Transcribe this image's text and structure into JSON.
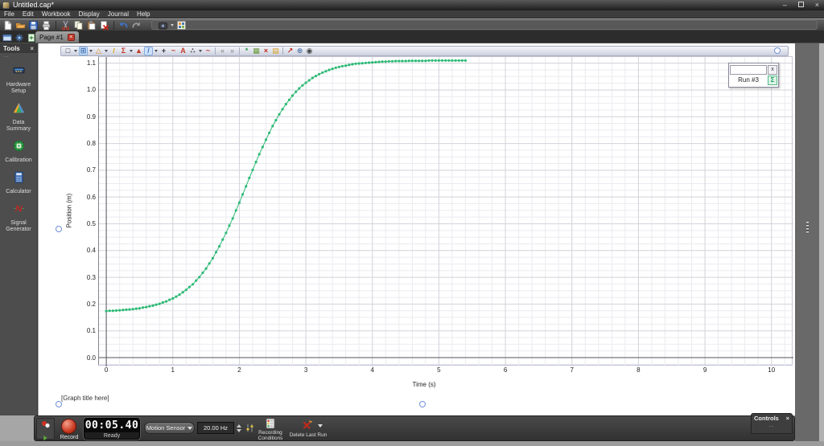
{
  "window": {
    "title": "Untitled.cap*"
  },
  "menu": {
    "items": [
      "File",
      "Edit",
      "Workbook",
      "Display",
      "Journal",
      "Help"
    ]
  },
  "main_toolbar": {
    "icons": [
      "new-file",
      "open-file",
      "save-file",
      "print",
      "sep",
      "cut",
      "copy",
      "paste",
      "delete-page",
      "sep",
      "undo",
      "redo"
    ],
    "right_icons": [
      "snapshot",
      "workbook-layout"
    ]
  },
  "tab_bar": {
    "icons": [
      "display-selector",
      "page-options",
      "add-page"
    ],
    "active_tab": "Page #1"
  },
  "tools_panel": {
    "title": "Tools",
    "items": [
      {
        "icon": "hardware-setup-icon",
        "label": "Hardware\nSetup"
      },
      {
        "icon": "data-summary-icon",
        "label": "Data\nSummary"
      },
      {
        "icon": "calibration-icon",
        "label": "Calibration"
      },
      {
        "icon": "calculator-icon",
        "label": "Calculator"
      },
      {
        "icon": "signal-generator-icon",
        "label": "Signal\nGenerator"
      }
    ]
  },
  "graph_display": {
    "toolbar_icons": [
      {
        "name": "selection-tool",
        "glyph": "□",
        "color": "#444444",
        "caret": true
      },
      {
        "name": "scale-to-fit-tool",
        "glyph": "⊞",
        "color": "#2a62a8",
        "caret": true,
        "active": true
      },
      {
        "name": "data-highlighter-tool",
        "glyph": "△",
        "color": "#e08a1e",
        "caret": true
      },
      {
        "name": "highlighter-pencil-tool",
        "glyph": "/",
        "color": "#d4a913"
      },
      {
        "name": "statistics-tool",
        "glyph": "Σ",
        "color": "#c23a2a",
        "caret": true
      },
      {
        "name": "delta-tool",
        "glyph": "▲",
        "color": "#c23a2a"
      },
      {
        "name": "slope-tool",
        "glyph": "/",
        "color": "#3a6fd0",
        "caret": true,
        "active": true
      },
      {
        "name": "coordinates-tool",
        "glyph": "+",
        "color": "#333333"
      },
      {
        "name": "curve-fit-tool",
        "glyph": "~",
        "color": "#c23a2a"
      },
      {
        "name": "annotation-tool",
        "glyph": "A",
        "color": "#c23a2a"
      },
      {
        "name": "multi-coordinates-tool",
        "glyph": "∴",
        "color": "#555555",
        "caret": true
      },
      {
        "name": "prediction-tool",
        "glyph": "~",
        "color": "#c23a2a"
      },
      {
        "name": "sep"
      },
      {
        "name": "previous-run-button",
        "glyph": "«",
        "color": "#9a9a9a"
      },
      {
        "name": "next-run-button",
        "glyph": "»",
        "color": "#9a9a9a"
      },
      {
        "name": "sep"
      },
      {
        "name": "add-display-button",
        "glyph": "*",
        "color": "#2e9e4e"
      },
      {
        "name": "select-runs-button",
        "glyph": "▦",
        "color": "#6a9a3a"
      },
      {
        "name": "delete-run-button",
        "glyph": "×",
        "color": "#c0281c"
      },
      {
        "name": "copy-display-button",
        "glyph": "▤",
        "color": "#d8a020"
      },
      {
        "name": "sep"
      },
      {
        "name": "pin-tool",
        "glyph": "↗",
        "color": "#c0281c"
      },
      {
        "name": "properties-button",
        "glyph": "⊛",
        "color": "#5577aa"
      },
      {
        "name": "visibility-button",
        "glyph": "◉",
        "color": "#444444"
      }
    ],
    "legend": {
      "title_field_value": "",
      "close_label": "x",
      "run_label": "Run #3",
      "run_selector_glyph": "Σ"
    },
    "title_placeholder": "[Graph title here]"
  },
  "chart_data": {
    "type": "line",
    "title": "[Graph title here]",
    "xlabel": "Time (s)",
    "ylabel": "Position (m)",
    "xlim": [
      -0.11,
      10.33
    ],
    "ylim": [
      -0.033,
      1.123
    ],
    "x_ticks": [
      0,
      1,
      2,
      3,
      4,
      5,
      6,
      7,
      8,
      9,
      10
    ],
    "y_ticks": [
      0.0,
      0.1,
      0.2,
      0.3,
      0.4,
      0.5,
      0.6,
      0.7,
      0.8,
      0.9,
      1.0,
      1.1
    ],
    "x_minor_step": 0.2,
    "y_minor_step": 0.025,
    "grid": true,
    "legend_position": "top-right",
    "colors": {
      "axis": "#52525c",
      "grid_major": "#d2d2da",
      "grid_minor": "#ebebf0"
    },
    "series": [
      {
        "name": "Run #3",
        "color": "#2eba76",
        "marker": "circle",
        "points": [
          [
            0.0,
            0.174
          ],
          [
            0.05,
            0.175
          ],
          [
            0.1,
            0.175
          ],
          [
            0.15,
            0.176
          ],
          [
            0.2,
            0.177
          ],
          [
            0.25,
            0.178
          ],
          [
            0.3,
            0.179
          ],
          [
            0.35,
            0.18
          ],
          [
            0.4,
            0.181
          ],
          [
            0.45,
            0.183
          ],
          [
            0.5,
            0.184
          ],
          [
            0.55,
            0.187
          ],
          [
            0.6,
            0.189
          ],
          [
            0.65,
            0.192
          ],
          [
            0.7,
            0.194
          ],
          [
            0.75,
            0.198
          ],
          [
            0.8,
            0.201
          ],
          [
            0.85,
            0.206
          ],
          [
            0.9,
            0.21
          ],
          [
            0.95,
            0.216
          ],
          [
            1.0,
            0.221
          ],
          [
            1.05,
            0.228
          ],
          [
            1.1,
            0.235
          ],
          [
            1.15,
            0.244
          ],
          [
            1.2,
            0.253
          ],
          [
            1.25,
            0.264
          ],
          [
            1.3,
            0.274
          ],
          [
            1.35,
            0.288
          ],
          [
            1.4,
            0.301
          ],
          [
            1.45,
            0.317
          ],
          [
            1.5,
            0.333
          ],
          [
            1.55,
            0.352
          ],
          [
            1.6,
            0.371
          ],
          [
            1.65,
            0.394
          ],
          [
            1.7,
            0.416
          ],
          [
            1.75,
            0.441
          ],
          [
            1.8,
            0.466
          ],
          [
            1.85,
            0.493
          ],
          [
            1.9,
            0.52
          ],
          [
            1.95,
            0.55
          ],
          [
            2.0,
            0.579
          ],
          [
            2.05,
            0.61
          ],
          [
            2.1,
            0.64
          ],
          [
            2.15,
            0.671
          ],
          [
            2.2,
            0.701
          ],
          [
            2.25,
            0.731
          ],
          [
            2.3,
            0.76
          ],
          [
            2.35,
            0.787
          ],
          [
            2.4,
            0.814
          ],
          [
            2.45,
            0.84
          ],
          [
            2.5,
            0.865
          ],
          [
            2.55,
            0.887
          ],
          [
            2.6,
            0.909
          ],
          [
            2.65,
            0.928
          ],
          [
            2.7,
            0.947
          ],
          [
            2.75,
            0.963
          ],
          [
            2.8,
            0.979
          ],
          [
            2.85,
            0.993
          ],
          [
            2.9,
            1.006
          ],
          [
            2.95,
            1.017
          ],
          [
            3.0,
            1.027
          ],
          [
            3.05,
            1.036
          ],
          [
            3.1,
            1.045
          ],
          [
            3.15,
            1.052
          ],
          [
            3.2,
            1.059
          ],
          [
            3.25,
            1.065
          ],
          [
            3.3,
            1.07
          ],
          [
            3.35,
            1.075
          ],
          [
            3.4,
            1.079
          ],
          [
            3.45,
            1.083
          ],
          [
            3.5,
            1.086
          ],
          [
            3.55,
            1.089
          ],
          [
            3.6,
            1.091
          ],
          [
            3.65,
            1.094
          ],
          [
            3.7,
            1.096
          ],
          [
            3.75,
            1.098
          ],
          [
            3.8,
            1.099
          ],
          [
            3.85,
            1.1
          ],
          [
            3.9,
            1.101
          ],
          [
            3.95,
            1.102
          ],
          [
            4.0,
            1.103
          ],
          [
            4.05,
            1.104
          ],
          [
            4.1,
            1.105
          ],
          [
            4.15,
            1.106
          ],
          [
            4.2,
            1.106
          ],
          [
            4.25,
            1.107
          ],
          [
            4.3,
            1.107
          ],
          [
            4.35,
            1.108
          ],
          [
            4.4,
            1.108
          ],
          [
            4.45,
            1.108
          ],
          [
            4.5,
            1.108
          ],
          [
            4.55,
            1.109
          ],
          [
            4.6,
            1.109
          ],
          [
            4.65,
            1.109
          ],
          [
            4.7,
            1.109
          ],
          [
            4.75,
            1.109
          ],
          [
            4.8,
            1.109
          ],
          [
            4.85,
            1.11
          ],
          [
            4.9,
            1.11
          ],
          [
            4.95,
            1.11
          ],
          [
            5.0,
            1.11
          ],
          [
            5.05,
            1.11
          ],
          [
            5.1,
            1.11
          ],
          [
            5.15,
            1.11
          ],
          [
            5.2,
            1.11
          ],
          [
            5.25,
            1.11
          ],
          [
            5.3,
            1.11
          ],
          [
            5.35,
            1.11
          ],
          [
            5.4,
            1.11
          ]
        ]
      }
    ]
  },
  "controls_bar": {
    "record_label": "Record",
    "timer_value": "00:05.40",
    "timer_status": "Ready",
    "sensor_button": "Motion Sensor",
    "sample_rate": "20.00 Hz",
    "recording_conditions_label": "Recording\nConditions",
    "delete_last_run_label": "Delete Last Run",
    "controls_panel": {
      "title": "Controls",
      "close_label": "×"
    }
  }
}
